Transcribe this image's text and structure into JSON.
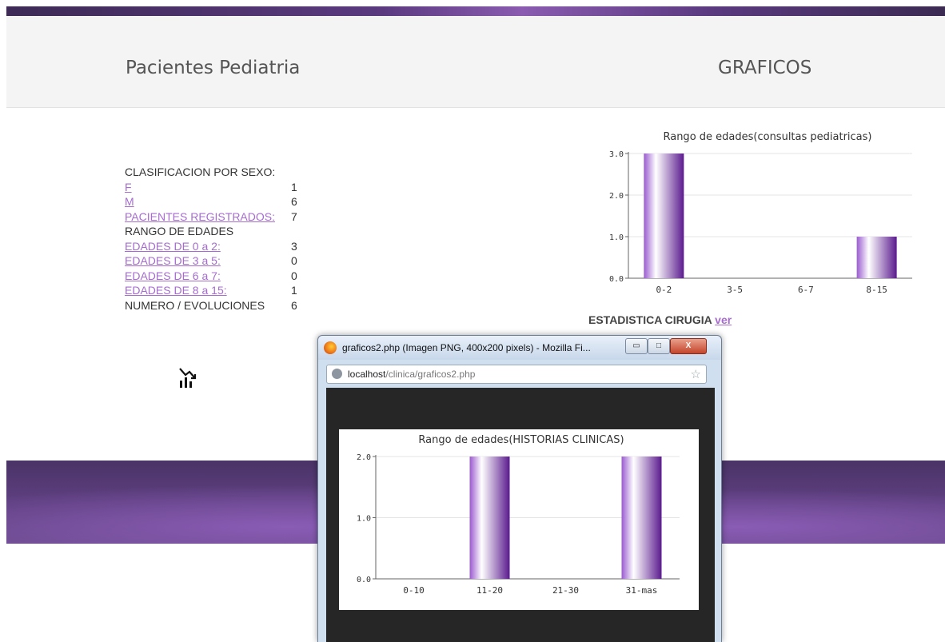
{
  "header": {
    "title_left": "Pacientes Pediatria",
    "title_right": "GRAFICOS"
  },
  "stats": {
    "heading": "CLASIFICACION POR SEXO:",
    "rows": [
      {
        "label": "F",
        "value": "1"
      },
      {
        "label": "M",
        "value": "6"
      },
      {
        "label": "PACIENTES REGISTRADOS:",
        "value": "7"
      }
    ],
    "age_heading": "RANGO DE EDADES",
    "age_rows": [
      {
        "label": "EDADES DE 0 a 2:",
        "value": "3"
      },
      {
        "label": "EDADES DE 3 a 5:",
        "value": "0"
      },
      {
        "label": "EDADES DE 6 a 7:",
        "value": "0"
      },
      {
        "label": "EDADES DE 8 a 15:",
        "value": "1"
      }
    ],
    "evoluciones_label": "NUMERO / EVOLUCIONES",
    "evoluciones_value": "6"
  },
  "cirugia": {
    "label": "ESTADISTICA CIRUGIA",
    "link": "ver"
  },
  "popup": {
    "title": "graficos2.php (Imagen PNG, 400x200 pixels) - Mozilla Fi...",
    "url_host": "localhost",
    "url_path": "/clinica/graficos2.php",
    "buttons": {
      "minimize": "▭",
      "maximize": "□",
      "close": "X"
    }
  },
  "chart_data": [
    {
      "type": "bar",
      "title": "Rango de edades(consultas pediatricas)",
      "categories": [
        "0-2",
        "3-5",
        "6-7",
        "8-15"
      ],
      "values": [
        3,
        0,
        0,
        1
      ],
      "ylim": [
        0,
        3
      ],
      "yticks": [
        "0.0",
        "1.0",
        "2.0",
        "3.0"
      ],
      "grid": true,
      "colors": {
        "bar_dark": "#5a1a8e",
        "bar_light": "#ffffff",
        "bar_mid": "#9a5ad0"
      }
    },
    {
      "type": "bar",
      "title": "Rango de edades(HISTORIAS CLINICAS)",
      "categories": [
        "0-10",
        "11-20",
        "21-30",
        "31-mas"
      ],
      "values": [
        0,
        2,
        0,
        2
      ],
      "ylim": [
        0,
        2
      ],
      "yticks": [
        "0.0",
        "1.0",
        "2.0"
      ],
      "grid": true,
      "colors": {
        "bar_dark": "#5a1a8e",
        "bar_light": "#ffffff",
        "bar_mid": "#9a5ad0"
      }
    }
  ]
}
